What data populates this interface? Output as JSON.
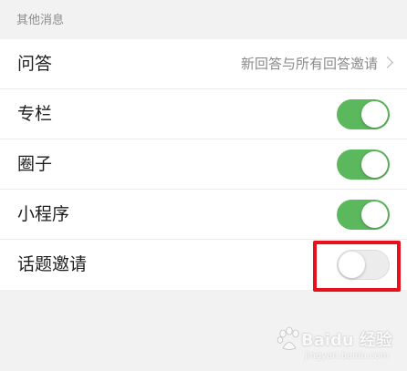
{
  "section": {
    "title": "其他消息"
  },
  "rows": [
    {
      "label": "问答",
      "value": "新回答与所有回答邀请",
      "type": "link"
    },
    {
      "label": "专栏",
      "type": "toggle",
      "enabled": true
    },
    {
      "label": "圈子",
      "type": "toggle",
      "enabled": true
    },
    {
      "label": "小程序",
      "type": "toggle",
      "enabled": true
    },
    {
      "label": "话题邀请",
      "type": "toggle",
      "enabled": false
    }
  ],
  "colors": {
    "toggle_on": "#5cb85c",
    "toggle_off": "#ececec",
    "highlight": "#e8111b",
    "background": "#f2f2f2"
  },
  "watermark": {
    "brand": "Baidu 经验",
    "url": "jingyan.baidu.com"
  },
  "icons": {
    "chevron": "chevron-right-icon",
    "watermark_logo": "baidu-paw-icon"
  }
}
